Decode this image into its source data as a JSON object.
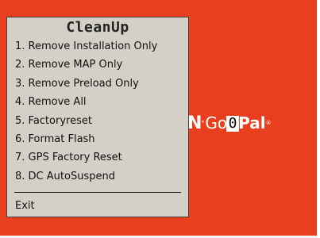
{
  "menu": {
    "title": "CleanUp",
    "items": [
      {
        "label": "1. Remove Installation Only"
      },
      {
        "label": "2. Remove MAP Only"
      },
      {
        "label": "3. Remove Preload Only"
      },
      {
        "label": "4. Remove All"
      },
      {
        "label": "5. Factoryreset"
      },
      {
        "label": "6. Format Flash"
      },
      {
        "label": "7. GPS Factory Reset"
      },
      {
        "label": "8. DC AutoSuspend"
      }
    ],
    "exit_label": "Exit"
  },
  "brand": {
    "prefix": "N",
    "go": "Go",
    "pal": "Pal",
    "overlay_char": "0"
  },
  "colors": {
    "background": "#e8401f",
    "menu": "#d4d0c8"
  }
}
